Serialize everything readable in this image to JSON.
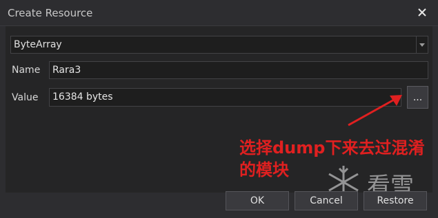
{
  "dialog": {
    "title": "Create Resource"
  },
  "type_select": {
    "value": "ByteArray"
  },
  "fields": {
    "name_label": "Name",
    "name_value": "Rara3",
    "value_label": "Value",
    "value_value": "16384 bytes",
    "browse_label": "..."
  },
  "annotation": {
    "text": "选择dump下来去过混淆的模块"
  },
  "footer": {
    "ok_label": "OK",
    "cancel_label": "Cancel",
    "restore_label": "Restore"
  },
  "watermark": {
    "text": "看雪"
  },
  "colors": {
    "background": "#2d2d30",
    "panel": "#252526",
    "input_bg": "#1e1e1e",
    "border": "#434346",
    "annotation": "#e02020"
  },
  "icons": {
    "close": "close-icon",
    "dropdown": "chevron-down-icon",
    "arrow": "annotation-arrow",
    "snowflake": "snowflake-icon"
  }
}
